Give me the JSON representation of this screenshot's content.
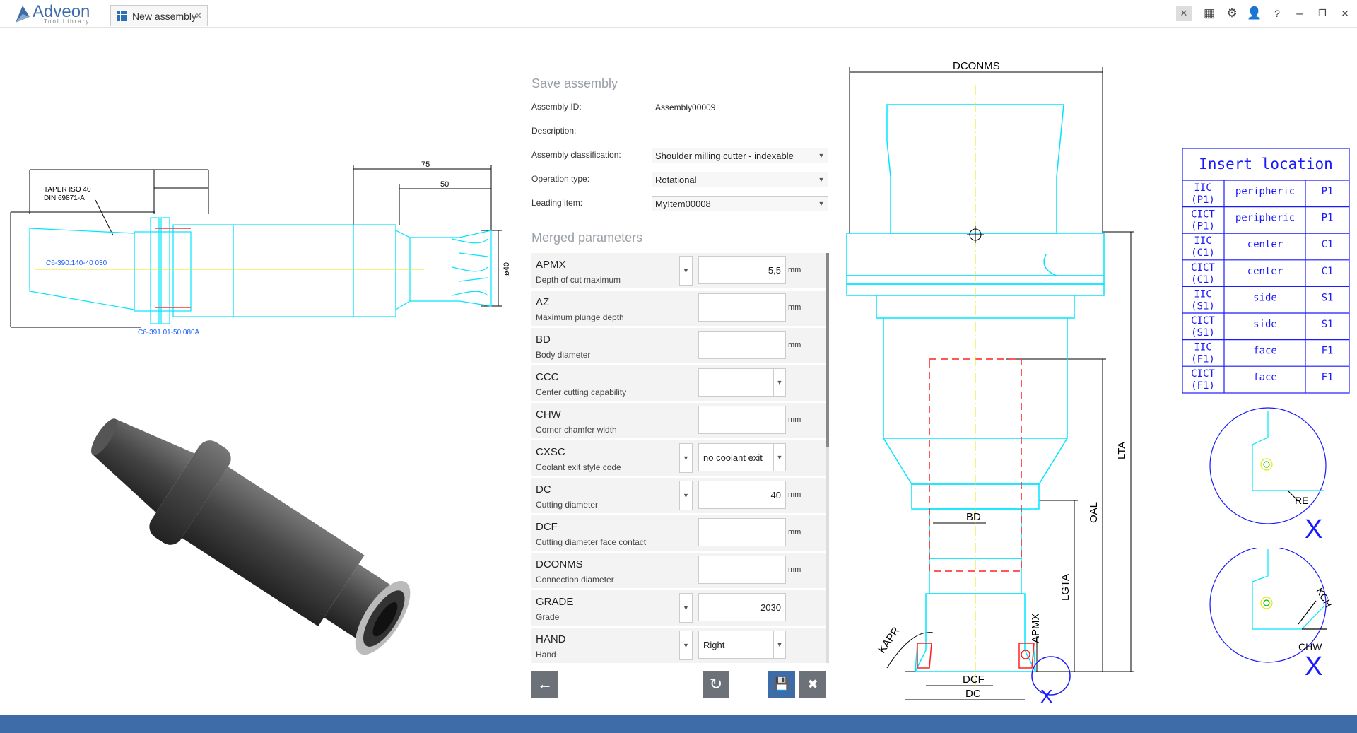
{
  "app": {
    "logo_name": "Adveon",
    "logo_sub": "Tool Library"
  },
  "tab": {
    "label": "New assembly",
    "close": "✕"
  },
  "toolbar": {
    "close": "✕",
    "apps": "▦",
    "settings": "⚙",
    "user": "👤",
    "help": "?",
    "minimize": "–",
    "restore": "❐",
    "close_window": "✕"
  },
  "form": {
    "title": "Save assembly",
    "assembly_id_label": "Assembly ID:",
    "assembly_id_value": "Assembly00009",
    "description_label": "Description:",
    "description_value": "",
    "classification_label": "Assembly classification:",
    "classification_value": "Shoulder milling cutter - indexable",
    "operation_label": "Operation type:",
    "operation_value": "Rotational",
    "leading_label": "Leading item:",
    "leading_value": "MyItem00008"
  },
  "merged": {
    "title": "Merged parameters",
    "rows": [
      {
        "name": "APMX",
        "desc": "Depth of cut maximum",
        "value": "5,5",
        "unit": "mm",
        "dropdown": true,
        "select": false
      },
      {
        "name": "AZ",
        "desc": "Maximum plunge depth",
        "value": "",
        "unit": "mm",
        "dropdown": false,
        "select": false
      },
      {
        "name": "BD",
        "desc": "Body diameter",
        "value": "",
        "unit": "mm",
        "dropdown": false,
        "select": false
      },
      {
        "name": "CCC",
        "desc": "Center cutting capability",
        "value": "",
        "unit": "",
        "dropdown": false,
        "select": true
      },
      {
        "name": "CHW",
        "desc": "Corner chamfer width",
        "value": "",
        "unit": "mm",
        "dropdown": false,
        "select": false
      },
      {
        "name": "CXSC",
        "desc": "Coolant exit style code",
        "value": "no coolant exit",
        "unit": "",
        "dropdown": true,
        "select": true
      },
      {
        "name": "DC",
        "desc": "Cutting diameter",
        "value": "40",
        "unit": "mm",
        "dropdown": true,
        "select": false
      },
      {
        "name": "DCF",
        "desc": "Cutting diameter face contact",
        "value": "",
        "unit": "mm",
        "dropdown": false,
        "select": false
      },
      {
        "name": "DCONMS",
        "desc": "Connection diameter",
        "value": "",
        "unit": "mm",
        "dropdown": false,
        "select": false
      },
      {
        "name": "GRADE",
        "desc": "Grade",
        "value": "2030",
        "unit": "",
        "dropdown": true,
        "select": false
      },
      {
        "name": "HAND",
        "desc": "Hand",
        "value": "Right",
        "unit": "",
        "dropdown": true,
        "select": true
      }
    ]
  },
  "actions": {
    "back": "←",
    "reset": "↻",
    "save": "💾",
    "cancel": "✖"
  },
  "left_drawing": {
    "dim_75": "75",
    "dim_50": "50",
    "dim_40": "ø40",
    "taper_label_1": "TAPER ISO 40",
    "taper_label_2": "DIN 69871-A",
    "part_1": "C6-390.140-40 030",
    "part_2": "C6-391.01-50 080A"
  },
  "right_drawing": {
    "dconms": "DCONMS",
    "bd": "BD",
    "dcf": "DCF",
    "dc": "DC",
    "lta": "LTA",
    "oal": "OAL",
    "lgta": "LGTA",
    "apmx": "APMX",
    "kapr": "KAPR",
    "x": "X"
  },
  "insert_location": {
    "title": "Insert location",
    "rows": [
      {
        "code": "IIC (P1)",
        "type": "peripheric",
        "loc": "P1"
      },
      {
        "code": "CICT (P1)",
        "type": "peripheric",
        "loc": "P1"
      },
      {
        "code": "IIC (C1)",
        "type": "center",
        "loc": "C1"
      },
      {
        "code": "CICT (C1)",
        "type": "center",
        "loc": "C1"
      },
      {
        "code": "IIC (S1)",
        "type": "side",
        "loc": "S1"
      },
      {
        "code": "CICT (S1)",
        "type": "side",
        "loc": "S1"
      },
      {
        "code": "IIC (F1)",
        "type": "face",
        "loc": "F1"
      },
      {
        "code": "CICT (F1)",
        "type": "face",
        "loc": "F1"
      }
    ],
    "re": "RE",
    "kch": "KCH",
    "chw": "CHW",
    "x1": "X",
    "x2": "X"
  },
  "colors": {
    "accent": "#3e6ca8",
    "cad": "#00e5ff",
    "blue": "#1a1aff"
  }
}
